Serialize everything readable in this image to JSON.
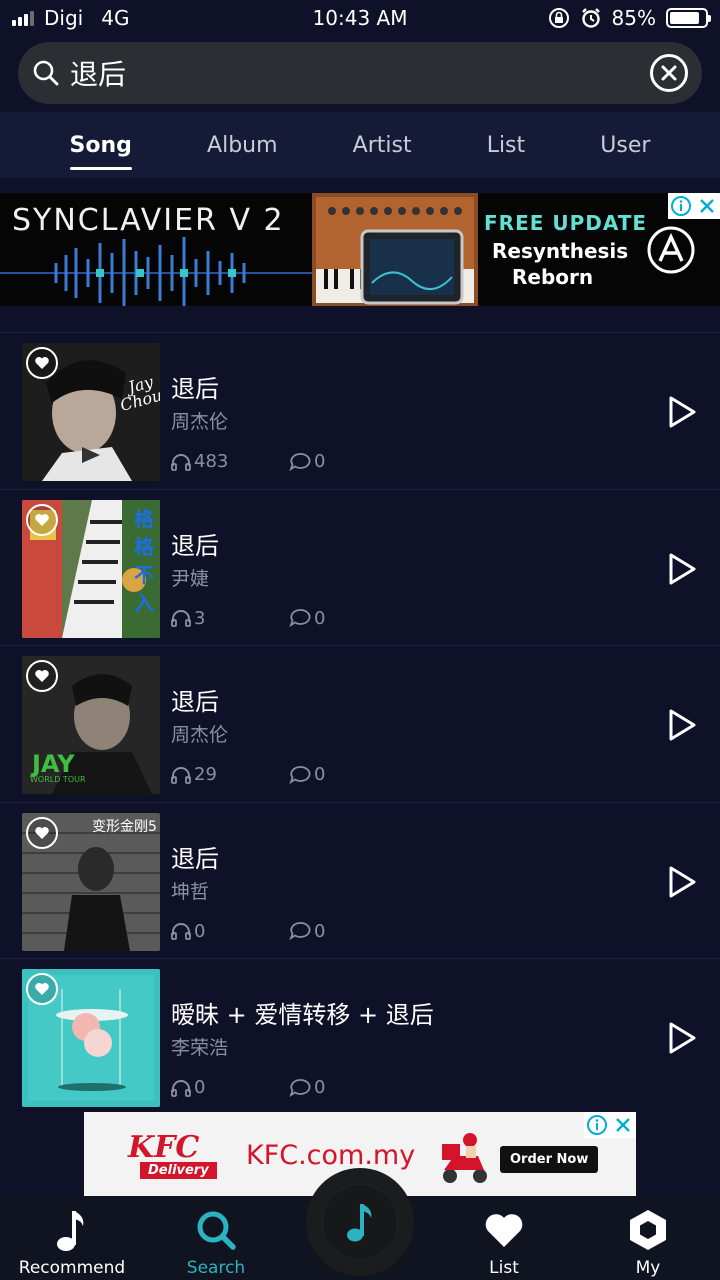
{
  "status_bar": {
    "carrier": "Digi",
    "network": "4G",
    "time": "10:43 AM",
    "battery": "85%",
    "battery_level": 0.85
  },
  "search": {
    "query": "退后",
    "placeholder": ""
  },
  "tabs": [
    {
      "label": "Song",
      "active": true
    },
    {
      "label": "Album",
      "active": false
    },
    {
      "label": "Artist",
      "active": false
    },
    {
      "label": "List",
      "active": false
    },
    {
      "label": "User",
      "active": false
    }
  ],
  "ad_top": {
    "brand": "SYNCLAVIER V 2",
    "promo_line1": "FREE UPDATE",
    "promo_line2": "Resynthesis",
    "promo_line3": "Reborn"
  },
  "songs": [
    {
      "title": "退后",
      "artist": "周杰伦",
      "plays": "483",
      "comments": "0",
      "cover_color": "#2b2b2b"
    },
    {
      "title": "退后",
      "artist": "尹婕",
      "plays": "3",
      "comments": "0",
      "cover_color": "#3b5a30"
    },
    {
      "title": "退后",
      "artist": "周杰伦",
      "plays": "29",
      "comments": "0",
      "cover_color": "#1d1d1d"
    },
    {
      "title": "退后",
      "artist": "坤哲",
      "plays": "0",
      "comments": "0",
      "cover_color": "#2a2a2a"
    },
    {
      "title": "暧昧 + 爱情转移 + 退后",
      "artist": "李荣浩",
      "plays": "0",
      "comments": "0",
      "cover_color": "#3cc1bf"
    }
  ],
  "ad_bottom": {
    "logo": "KFC",
    "logo_sub": "Delivery",
    "url": "KFC.com.my",
    "cta": "Order Now"
  },
  "nav": [
    {
      "label": "Recommend",
      "active": false
    },
    {
      "label": "Search",
      "active": true
    },
    {
      "label": "List",
      "active": false
    },
    {
      "label": "My",
      "active": false
    }
  ],
  "colors": {
    "background": "#0e1128",
    "accent": "#2bb3c0",
    "muted_text": "#8b8fa3"
  }
}
